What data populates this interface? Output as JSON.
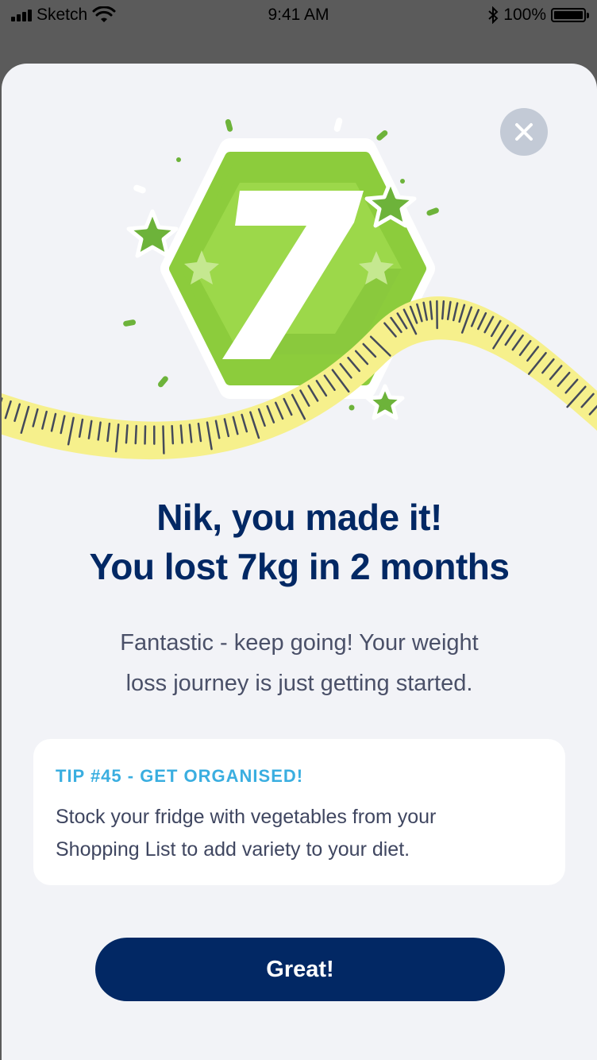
{
  "status_bar": {
    "carrier": "Sketch",
    "time": "9:41 AM",
    "battery": "100%"
  },
  "badge": {
    "number": "7"
  },
  "headline": {
    "line1": "Nik, you made it!",
    "line2": "You lost 7kg in 2 months"
  },
  "subtext": {
    "line1": "Fantastic - keep going!  Your weight",
    "line2": "loss journey is just getting started."
  },
  "tip": {
    "title": "TIP #45 - GET ORGANISED!",
    "line1": "Stock your fridge with vegetables from your",
    "line2": "Shopping List to add variety to your diet."
  },
  "actions": {
    "primary": "Great!"
  },
  "icons": {
    "close": "close-icon",
    "signal": "signal-icon",
    "wifi": "wifi-icon",
    "bluetooth": "bluetooth-icon",
    "battery": "battery-icon"
  },
  "colors": {
    "navy": "#022864",
    "tip_accent": "#3aaee0",
    "badge_green": "#8ccc3c",
    "tape_yellow": "#f6f08c"
  }
}
